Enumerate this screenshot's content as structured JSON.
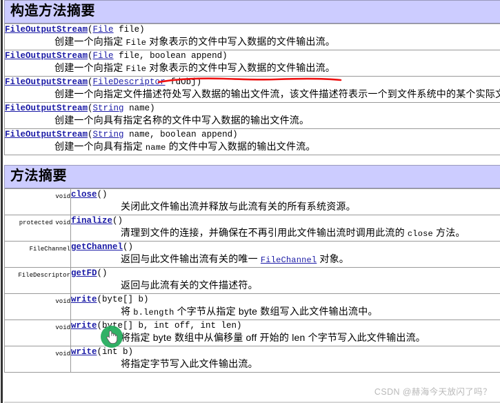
{
  "constructor_section": {
    "banner_title": "构造方法摘要",
    "rows": [
      {
        "link": "FileOutputStream",
        "open": "(",
        "param_link": "File",
        "param_rest": " file)",
        "desc_pre": "创建一个向指定 ",
        "desc_mono": "File",
        "desc_post": " 对象表示的文件中写入数据的文件输出流。"
      },
      {
        "link": "FileOutputStream",
        "open": "(",
        "param_link": "File",
        "param_rest": " file, boolean append)",
        "desc_pre": "创建一个向指定 ",
        "desc_mono": "File",
        "desc_post": " 对象表示的文件中写入数据的文件输出流。"
      },
      {
        "link": "FileOutputStream",
        "open": "(",
        "param_link": "FileDescriptor",
        "param_rest": " fdObj)",
        "desc_pre": "创建一个向指定文件描述符处写入数据的输出文件流，该文件描述符表示一个到文件系统中的某个实际文件的现有连接。",
        "desc_mono": "",
        "desc_post": ""
      },
      {
        "link": "FileOutputStream",
        "open": "(",
        "param_link": "String",
        "param_rest": " name)",
        "desc_pre": "创建一个向具有指定名称的文件中写入数据的输出文件流。",
        "desc_mono": "",
        "desc_post": ""
      },
      {
        "link": "FileOutputStream",
        "open": "(",
        "param_link": "String",
        "param_rest": " name, boolean append)",
        "desc_pre": "创建一个向具有指定 ",
        "desc_mono": "name",
        "desc_post": " 的文件中写入数据的输出文件流。"
      }
    ]
  },
  "method_section": {
    "banner_title": "方法摘要",
    "rows": [
      {
        "modifiers": "",
        "return_type": "void",
        "return_type_is_link": false,
        "name": "close",
        "signature": "()",
        "desc_pre": "关闭此文件输出流并释放与此流有关的所有系统资源。",
        "desc_mono": "",
        "desc_post": ""
      },
      {
        "modifiers": "protected",
        "return_type": "void",
        "return_type_is_link": false,
        "name": "finalize",
        "signature": "()",
        "desc_pre": "清理到文件的连接，并确保在不再引用此文件输出流时调用此流的 ",
        "desc_mono": "close",
        "desc_post": " 方法。"
      },
      {
        "modifiers": "",
        "return_type": "FileChannel",
        "return_type_is_link": true,
        "name": "getChannel",
        "signature": "()",
        "desc_pre": "返回与此文件输出流有关的唯一 ",
        "desc_mono": "FileChannel",
        "desc_mono_is_link": true,
        "desc_post": " 对象。"
      },
      {
        "modifiers": "",
        "return_type": "FileDescriptor",
        "return_type_is_link": true,
        "name": "getFD",
        "signature": "()",
        "desc_pre": "返回与此流有关的文件描述符。",
        "desc_mono": "",
        "desc_post": ""
      },
      {
        "modifiers": "",
        "return_type": "void",
        "return_type_is_link": false,
        "name": "write",
        "signature": "(byte[] b)",
        "desc_pre": "将 ",
        "desc_mono": "b.length",
        "desc_post": " 个字节从指定 byte 数组写入此文件输出流中。"
      },
      {
        "modifiers": "",
        "return_type": "void",
        "return_type_is_link": false,
        "name": "write",
        "signature": "(byte[] b, int off, int len)",
        "desc_pre": "将指定 byte 数组中从偏移量 off 开始的 len 个字节写入此文件输出流。",
        "desc_mono": "",
        "desc_post": ""
      },
      {
        "modifiers": "",
        "return_type": "void",
        "return_type_is_link": false,
        "name": "write",
        "signature": "(int b)",
        "desc_pre": "将指定字节写入此文件输出流。",
        "desc_mono": "",
        "desc_post": ""
      }
    ]
  },
  "annotations": {
    "red_underline_color": "#ee1111",
    "cursor_highlight_color": "#1faa59",
    "cursor_icon": "hand-pointer-icon"
  },
  "watermark": {
    "text": "CSDN @赫海今天放闪了吗？",
    "color": "#b9b9b9"
  }
}
